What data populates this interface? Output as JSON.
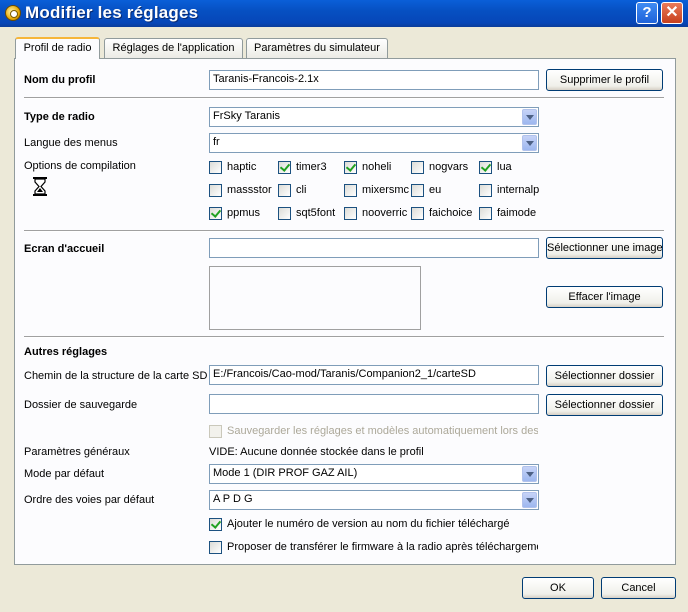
{
  "window": {
    "title": "Modifier les réglages",
    "help_glyph": "?",
    "close_glyph": "✕"
  },
  "tabs": [
    {
      "label": "Profil de radio",
      "active": true
    },
    {
      "label": "Réglages de l'application",
      "active": false
    },
    {
      "label": "Paramètres du simulateur",
      "active": false
    }
  ],
  "profile": {
    "name_label": "Nom du profil",
    "name_value": "Taranis-Francois-2.1x",
    "delete_button": "Supprimer le profil"
  },
  "radio": {
    "type_label": "Type de radio",
    "type_value": "FrSky Taranis",
    "menu_lang_label": "Langue des menus",
    "menu_lang_value": "fr",
    "build_options_label": "Options de compilation",
    "options": [
      {
        "label": "haptic",
        "checked": false
      },
      {
        "label": "timer3",
        "checked": true
      },
      {
        "label": "noheli",
        "checked": true
      },
      {
        "label": "nogvars",
        "checked": false
      },
      {
        "label": "lua",
        "checked": true
      },
      {
        "label": "massstor",
        "checked": false
      },
      {
        "label": "cli",
        "checked": false
      },
      {
        "label": "mixersmc",
        "checked": false
      },
      {
        "label": "eu",
        "checked": false
      },
      {
        "label": "internalp",
        "checked": false
      },
      {
        "label": "ppmus",
        "checked": true
      },
      {
        "label": "sqt5font",
        "checked": false
      },
      {
        "label": "nooverric",
        "checked": false
      },
      {
        "label": "faichoice",
        "checked": false
      },
      {
        "label": "faimode",
        "checked": false
      }
    ]
  },
  "splash": {
    "label": "Ecran d'accueil",
    "value": "",
    "select_button": "Sélectionner une image",
    "clear_button": "Effacer l'image"
  },
  "other": {
    "heading": "Autres réglages",
    "sd_path_label": "Chemin de la structure de la carte SD",
    "sd_path_value": "E:/Francois/Cao-mod/Taranis/Companion2_1/carteSD",
    "sd_select_button": "Sélectionner dossier",
    "backup_label": "Dossier de sauvegarde",
    "backup_value": "",
    "backup_select_button": "Sélectionner dossier",
    "auto_backup_label": "Sauvegarder les réglages et modèles automatiquement lors des t",
    "auto_backup_checked": false,
    "general_params_label": "Paramètres généraux",
    "general_params_value": "VIDE: Aucune donnée stockée dans le profil",
    "default_mode_label": "Mode par défaut",
    "default_mode_value": "Mode 1 (DIR PROF GAZ AIL)",
    "channel_order_label": "Ordre des voies par défaut",
    "channel_order_value": "A P D G",
    "append_version_label": "Ajouter le numéro de version au nom du fichier téléchargé",
    "append_version_checked": true,
    "offer_flash_label": "Proposer de transférer le firmware à la radio après téléchargeme",
    "offer_flash_checked": false
  },
  "footer": {
    "ok": "OK",
    "cancel": "Cancel"
  }
}
